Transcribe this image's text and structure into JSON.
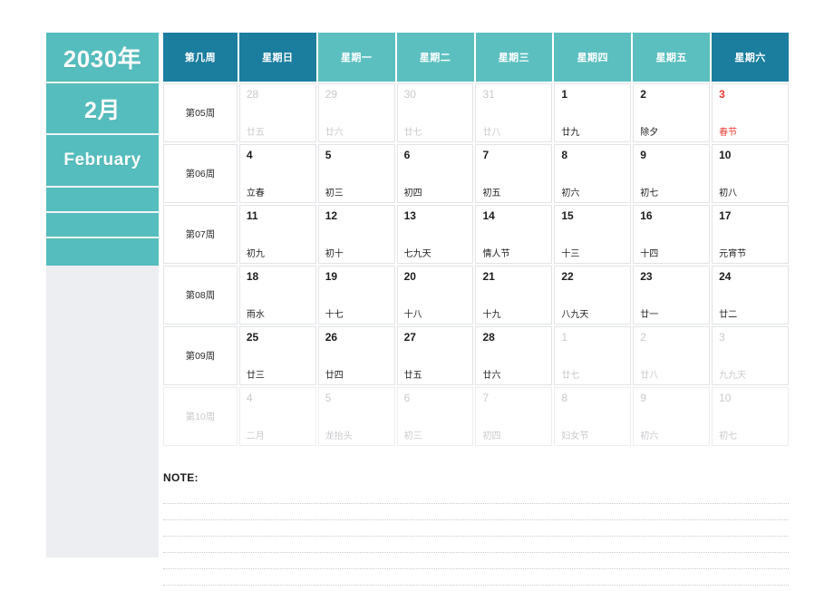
{
  "sidebar": {
    "year": "2030年",
    "month": "2月",
    "english_month": "February"
  },
  "calendar": {
    "headers": [
      {
        "label": "第几周",
        "tone": "dark"
      },
      {
        "label": "星期日",
        "tone": "dark"
      },
      {
        "label": "星期一",
        "tone": "light"
      },
      {
        "label": "星期二",
        "tone": "light"
      },
      {
        "label": "星期三",
        "tone": "light"
      },
      {
        "label": "星期四",
        "tone": "light"
      },
      {
        "label": "星期五",
        "tone": "light"
      },
      {
        "label": "星期六",
        "tone": "dark"
      }
    ],
    "rows": [
      {
        "week": "第05周",
        "muted_row": false,
        "days": [
          {
            "num": "28",
            "lunar": "廿五",
            "muted": true,
            "holiday": false
          },
          {
            "num": "29",
            "lunar": "廿六",
            "muted": true,
            "holiday": false
          },
          {
            "num": "30",
            "lunar": "廿七",
            "muted": true,
            "holiday": false
          },
          {
            "num": "31",
            "lunar": "廿八",
            "muted": true,
            "holiday": false
          },
          {
            "num": "1",
            "lunar": "廿九",
            "muted": false,
            "holiday": false
          },
          {
            "num": "2",
            "lunar": "除夕",
            "muted": false,
            "holiday": false
          },
          {
            "num": "3",
            "lunar": "春节",
            "muted": false,
            "holiday": true
          }
        ]
      },
      {
        "week": "第06周",
        "muted_row": false,
        "days": [
          {
            "num": "4",
            "lunar": "立春",
            "muted": false,
            "holiday": false
          },
          {
            "num": "5",
            "lunar": "初三",
            "muted": false,
            "holiday": false
          },
          {
            "num": "6",
            "lunar": "初四",
            "muted": false,
            "holiday": false
          },
          {
            "num": "7",
            "lunar": "初五",
            "muted": false,
            "holiday": false
          },
          {
            "num": "8",
            "lunar": "初六",
            "muted": false,
            "holiday": false
          },
          {
            "num": "9",
            "lunar": "初七",
            "muted": false,
            "holiday": false
          },
          {
            "num": "10",
            "lunar": "初八",
            "muted": false,
            "holiday": false
          }
        ]
      },
      {
        "week": "第07周",
        "muted_row": false,
        "days": [
          {
            "num": "11",
            "lunar": "初九",
            "muted": false,
            "holiday": false
          },
          {
            "num": "12",
            "lunar": "初十",
            "muted": false,
            "holiday": false
          },
          {
            "num": "13",
            "lunar": "七九天",
            "muted": false,
            "holiday": false
          },
          {
            "num": "14",
            "lunar": "情人节",
            "muted": false,
            "holiday": false
          },
          {
            "num": "15",
            "lunar": "十三",
            "muted": false,
            "holiday": false
          },
          {
            "num": "16",
            "lunar": "十四",
            "muted": false,
            "holiday": false
          },
          {
            "num": "17",
            "lunar": "元宵节",
            "muted": false,
            "holiday": false
          }
        ]
      },
      {
        "week": "第08周",
        "muted_row": false,
        "days": [
          {
            "num": "18",
            "lunar": "雨水",
            "muted": false,
            "holiday": false
          },
          {
            "num": "19",
            "lunar": "十七",
            "muted": false,
            "holiday": false
          },
          {
            "num": "20",
            "lunar": "十八",
            "muted": false,
            "holiday": false
          },
          {
            "num": "21",
            "lunar": "十九",
            "muted": false,
            "holiday": false
          },
          {
            "num": "22",
            "lunar": "八九天",
            "muted": false,
            "holiday": false
          },
          {
            "num": "23",
            "lunar": "廿一",
            "muted": false,
            "holiday": false
          },
          {
            "num": "24",
            "lunar": "廿二",
            "muted": false,
            "holiday": false
          }
        ]
      },
      {
        "week": "第09周",
        "muted_row": false,
        "days": [
          {
            "num": "25",
            "lunar": "廿三",
            "muted": false,
            "holiday": false
          },
          {
            "num": "26",
            "lunar": "廿四",
            "muted": false,
            "holiday": false
          },
          {
            "num": "27",
            "lunar": "廿五",
            "muted": false,
            "holiday": false
          },
          {
            "num": "28",
            "lunar": "廿六",
            "muted": false,
            "holiday": false
          },
          {
            "num": "1",
            "lunar": "廿七",
            "muted": true,
            "holiday": false
          },
          {
            "num": "2",
            "lunar": "廿八",
            "muted": true,
            "holiday": false
          },
          {
            "num": "3",
            "lunar": "九九天",
            "muted": true,
            "holiday": false
          }
        ]
      },
      {
        "week": "第10周",
        "muted_row": true,
        "days": [
          {
            "num": "4",
            "lunar": "二月",
            "muted": true,
            "holiday": false
          },
          {
            "num": "5",
            "lunar": "龙抬头",
            "muted": true,
            "holiday": false
          },
          {
            "num": "6",
            "lunar": "初三",
            "muted": true,
            "holiday": false
          },
          {
            "num": "7",
            "lunar": "初四",
            "muted": true,
            "holiday": false
          },
          {
            "num": "8",
            "lunar": "妇女节",
            "muted": true,
            "holiday": false
          },
          {
            "num": "9",
            "lunar": "初六",
            "muted": true,
            "holiday": false
          },
          {
            "num": "10",
            "lunar": "初七",
            "muted": true,
            "holiday": false
          }
        ]
      }
    ]
  },
  "note": {
    "label": "NOTE:",
    "line_count": 6
  },
  "colors": {
    "header_dark": "#1b7e9e",
    "header_light": "#5cbfbf",
    "sidebar_teal": "#55bdbd",
    "sidebar_gray": "#edeef2",
    "holiday_red": "#ef3c34",
    "muted_text": "#c8c9cc"
  }
}
